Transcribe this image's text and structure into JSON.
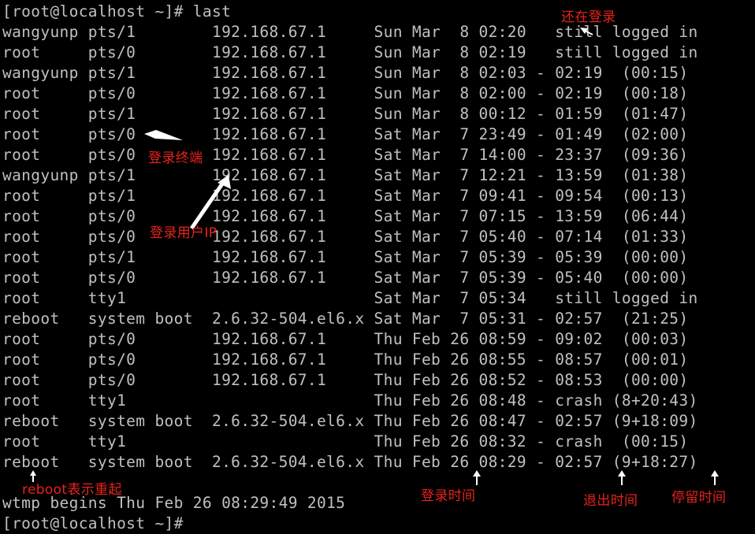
{
  "terminal": {
    "lines": [
      "[root@localhost ~]# last",
      "wangyunp pts/1        192.168.67.1     Sun Mar  8 02:20   still logged in",
      "root     pts/0        192.168.67.1     Sun Mar  8 02:19   still logged in",
      "wangyunp pts/1        192.168.67.1     Sun Mar  8 02:03 - 02:19  (00:15)",
      "root     pts/0        192.168.67.1     Sun Mar  8 02:00 - 02:19  (00:18)",
      "root     pts/1        192.168.67.1     Sun Mar  8 00:12 - 01:59  (01:47)",
      "root     pts/0        192.168.67.1     Sat Mar  7 23:49 - 01:49  (02:00)",
      "root     pts/0        192.168.67.1     Sat Mar  7 14:00 - 23:37  (09:36)",
      "wangyunp pts/1        192.168.67.1     Sat Mar  7 12:21 - 13:59  (01:38)",
      "root     pts/1        192.168.67.1     Sat Mar  7 09:41 - 09:54  (00:13)",
      "root     pts/0        192.168.67.1     Sat Mar  7 07:15 - 13:59  (06:44)",
      "root     pts/0        192.168.67.1     Sat Mar  7 05:40 - 07:14  (01:33)",
      "root     pts/1        192.168.67.1     Sat Mar  7 05:39 - 05:39  (00:00)",
      "root     pts/0        192.168.67.1     Sat Mar  7 05:39 - 05:40  (00:00)",
      "root     tty1                          Sat Mar  7 05:34   still logged in",
      "reboot   system boot  2.6.32-504.el6.x Sat Mar  7 05:31 - 02:57  (21:25)",
      "root     pts/0        192.168.67.1     Thu Feb 26 08:59 - 09:02  (00:03)",
      "root     pts/0        192.168.67.1     Thu Feb 26 08:55 - 08:57  (00:01)",
      "root     pts/0        192.168.67.1     Thu Feb 26 08:52 - 08:53  (00:00)",
      "root     tty1                          Thu Feb 26 08:48 - crash (8+20:43)",
      "reboot   system boot  2.6.32-504.el6.x Thu Feb 26 08:47 - 02:57 (9+18:09)",
      "root     tty1                          Thu Feb 26 08:32 - crash  (00:15)",
      "reboot   system boot  2.6.32-504.el6.x Thu Feb 26 08:29 - 02:57 (9+18:27)",
      "",
      "wtmp begins Thu Feb 26 08:29:49 2015",
      "[root@localhost ~]#"
    ]
  },
  "annotations": {
    "still_logged_in": "还在登录",
    "login_terminal": "登录终端",
    "login_user_ip": "登录用户IP",
    "reboot_meaning": "reboot表示重起",
    "login_time": "登录时间",
    "logout_time": "退出时间",
    "stay_time": "停留时间"
  },
  "colors": {
    "background": "#000000",
    "text": "#c0c0c0",
    "annotation": "#e8231c",
    "arrow": "#ffffff"
  }
}
